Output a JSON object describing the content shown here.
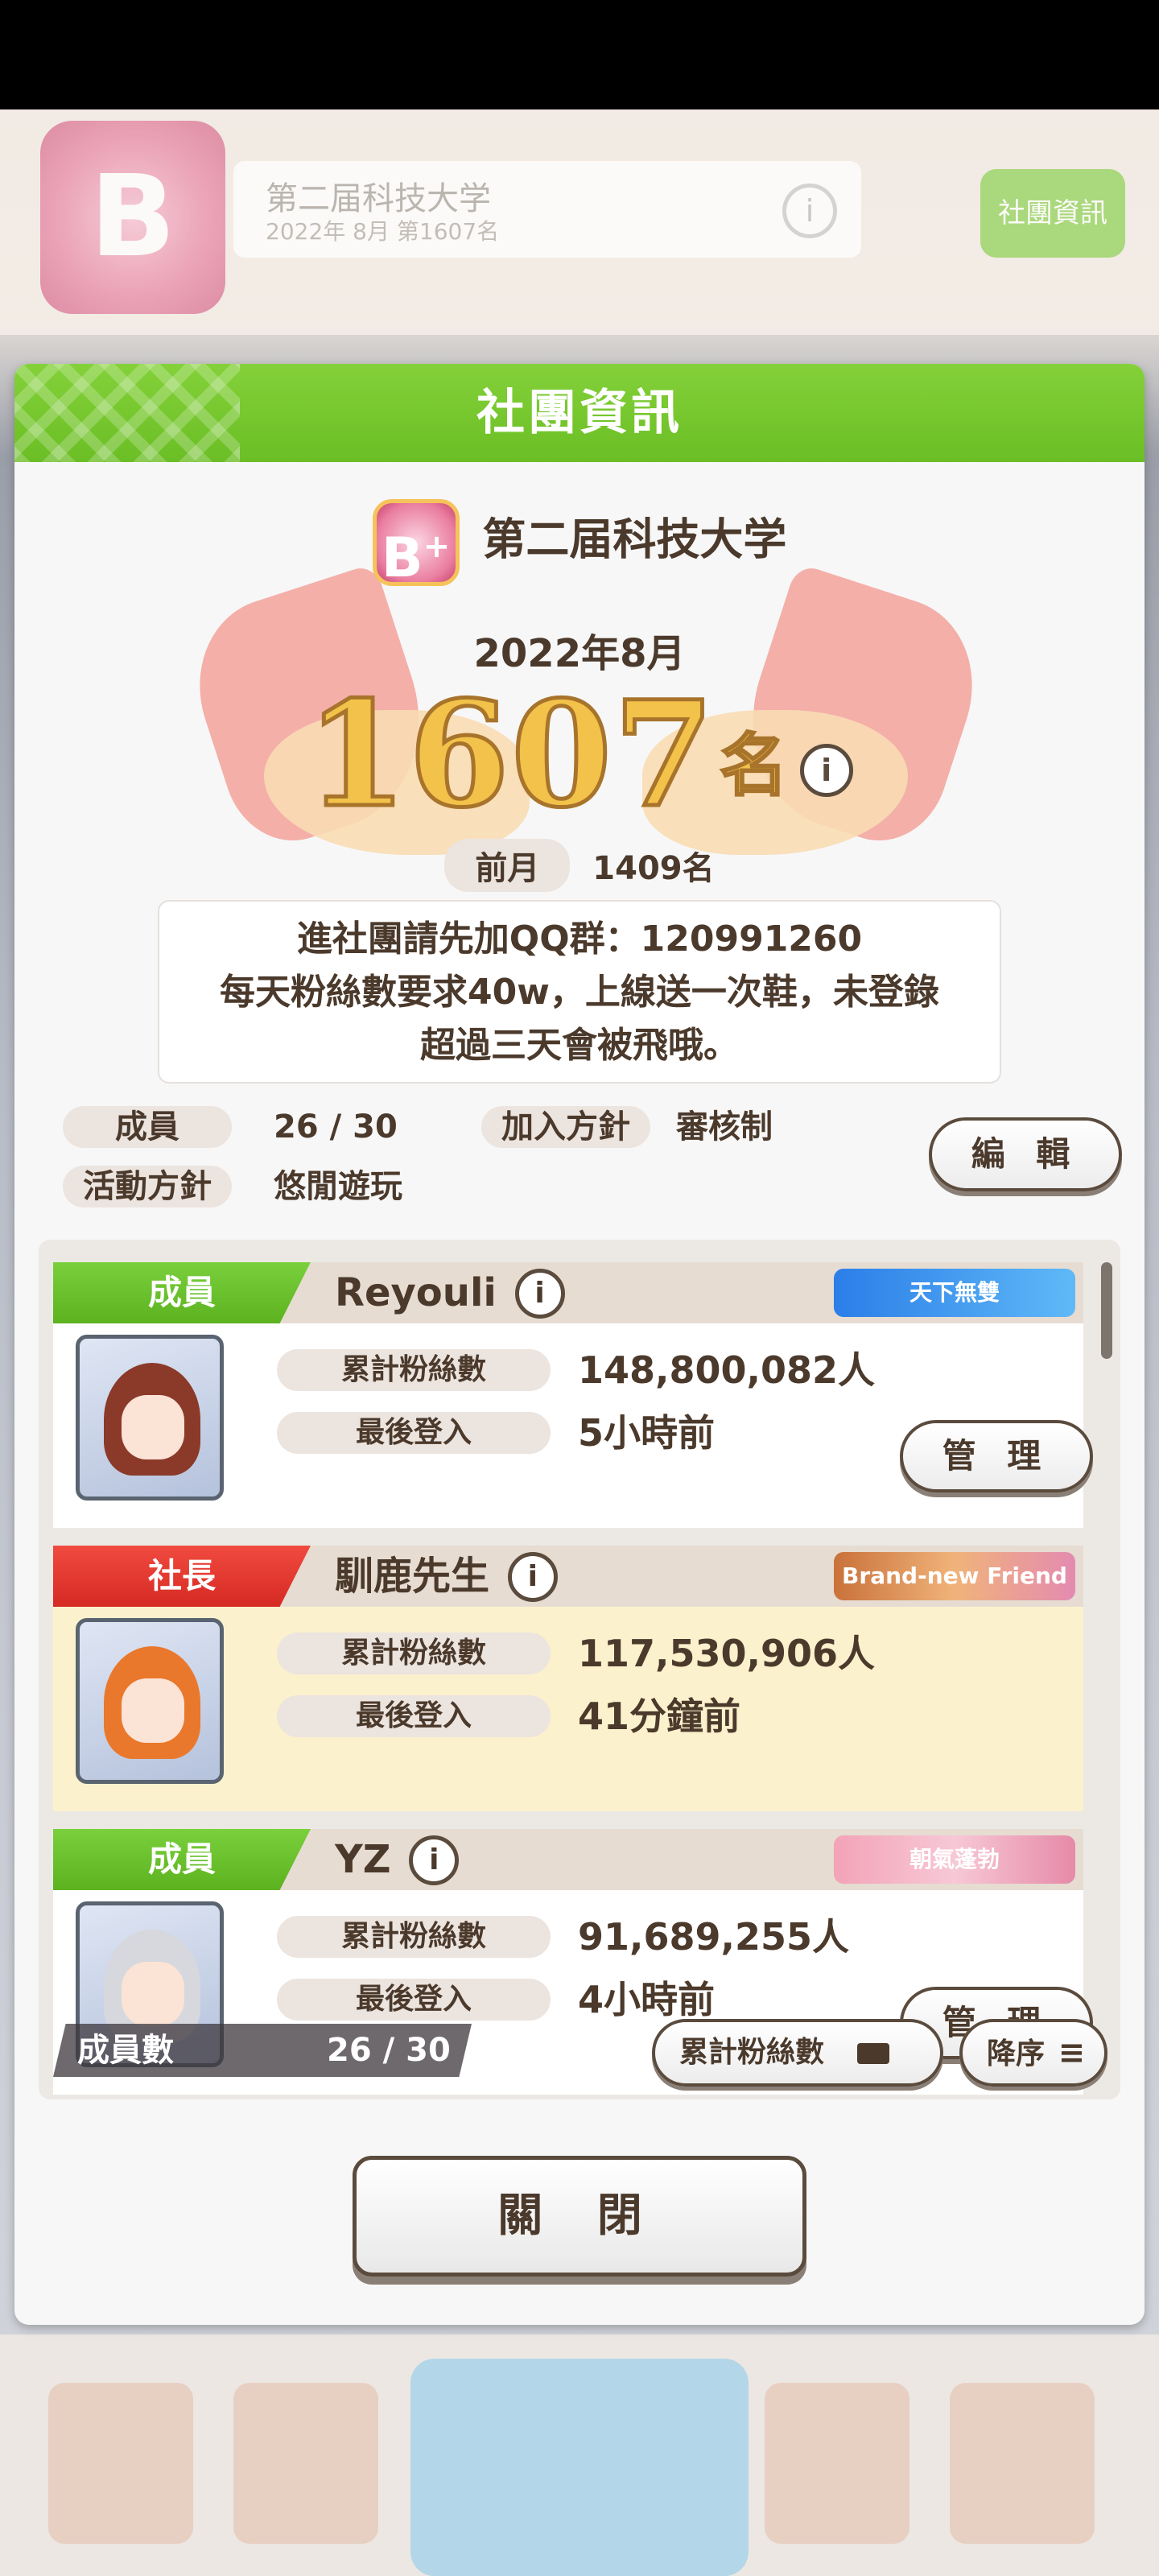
{
  "background": {
    "circle_rank": "B",
    "circle_name": "第二届科技大学",
    "circle_sub": "2022年 8月 第1607名",
    "right_button": "社團資訊"
  },
  "modal": {
    "title": "社團資訊",
    "circle_name": "第二届科技大学",
    "rank_letter": "B",
    "rank_plus": "+",
    "month": "2022年8月",
    "rank": "1607",
    "rank_unit": "名",
    "prev_label": "前月",
    "prev_value": "1409名",
    "notice_lines": [
      "進社團請先加QQ群：120991260",
      "每天粉絲數要求40w，上線送一次鞋，未登錄",
      "超過三天會被飛哦。"
    ],
    "members_label": "成員",
    "members_value": "26 / 30",
    "join_label": "加入方針",
    "join_value": "審核制",
    "policy_label": "活動方針",
    "policy_value": "悠閒遊玩",
    "edit_button": "編 輯"
  },
  "members": [
    {
      "role": "成員",
      "name": "Reyouli",
      "badge": "天下無雙",
      "fans_label": "累計粉絲數",
      "fans": "148,800,082人",
      "login_label": "最後登入",
      "login": "5小時前",
      "manage": "管 理"
    },
    {
      "role": "社長",
      "name": "馴鹿先生",
      "badge": "Brand-new Friend",
      "fans_label": "累計粉絲數",
      "fans": "117,530,906人",
      "login_label": "最後登入",
      "login": "41分鐘前"
    },
    {
      "role": "成員",
      "name": "YZ",
      "badge": "朝氣蓬勃",
      "fans_label": "累計粉絲數",
      "fans": "91,689,255人",
      "login_label": "最後登入",
      "login": "4小時前",
      "manage": "管 理"
    }
  ],
  "footer": {
    "count_label": "成員數",
    "count_value": "26 / 30",
    "sort_key": "累計粉絲數",
    "sort_order": "降序",
    "close_button": "關 閉"
  },
  "colors": {
    "header_green": "#6bbe25",
    "leader_red": "#d62a24",
    "rank_gold": "#f2c24a",
    "text_brown": "#4b3a2c"
  }
}
